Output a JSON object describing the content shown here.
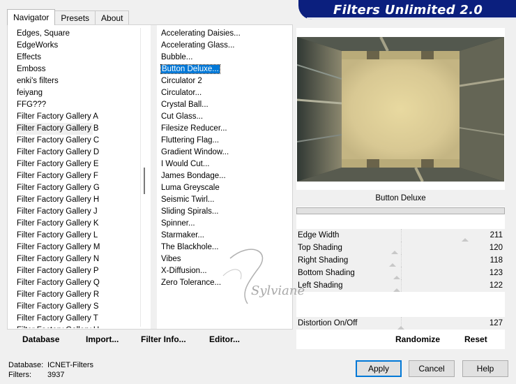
{
  "window": {
    "title": "Filters Unlimited 2.0"
  },
  "tabs": [
    {
      "label": "Navigator",
      "active": true
    },
    {
      "label": "Presets",
      "active": false
    },
    {
      "label": "About",
      "active": false
    }
  ],
  "categories": {
    "items": [
      "Edges, Square",
      "EdgeWorks",
      "Effects",
      "Emboss",
      "enki's filters",
      "feiyang",
      "FFG???",
      "Filter Factory Gallery A",
      "Filter Factory Gallery B",
      "Filter Factory Gallery C",
      "Filter Factory Gallery D",
      "Filter Factory Gallery E",
      "Filter Factory Gallery F",
      "Filter Factory Gallery G",
      "Filter Factory Gallery H",
      "Filter Factory Gallery J",
      "Filter Factory Gallery K",
      "Filter Factory Gallery L",
      "Filter Factory Gallery M",
      "Filter Factory Gallery N",
      "Filter Factory Gallery P",
      "Filter Factory Gallery Q",
      "Filter Factory Gallery R",
      "Filter Factory Gallery S",
      "Filter Factory Gallery T",
      "Filter Factory Gallery U"
    ],
    "selected": "Filter Factory Gallery B"
  },
  "filters": {
    "items": [
      "Accelerating Daisies...",
      "Accelerating Glass...",
      "Bubble...",
      "Button Deluxe...",
      "Circulator 2",
      "Circulator...",
      "Crystal Ball...",
      "Cut Glass...",
      "Filesize Reducer...",
      "Fluttering Flag...",
      "Gradient Window...",
      "I Would Cut...",
      "James Bondage...",
      "Luma Greyscale",
      "Seismic Twirl...",
      "Sliding Spirals...",
      "Spinner...",
      "Starmaker...",
      "The Blackhole...",
      "Vibes",
      "X-Diffusion...",
      "Zero Tolerance..."
    ],
    "selected": "Button Deluxe..."
  },
  "left_buttons": {
    "database": "Database",
    "import": "Import...",
    "filter_info": "Filter Info...",
    "editor": "Editor..."
  },
  "preview": {
    "filter_name": "Button Deluxe"
  },
  "params": [
    {
      "label": "Edge Width",
      "value": "211",
      "level": 0.83
    },
    {
      "label": "Top Shading",
      "value": "120",
      "level": 0.47
    },
    {
      "label": "Right Shading",
      "value": "118",
      "level": 0.46
    },
    {
      "label": "Bottom Shading",
      "value": "123",
      "level": 0.48
    },
    {
      "label": "Left Shading",
      "value": "122",
      "level": 0.48
    },
    {
      "label": "",
      "value": "",
      "level": null
    },
    {
      "label": "",
      "value": "",
      "level": null
    },
    {
      "label": "Distortion On/Off",
      "value": "127",
      "level": 0.5
    }
  ],
  "right_buttons": {
    "randomize": "Randomize",
    "reset": "Reset"
  },
  "status": {
    "database_label": "Database:",
    "database_value": "ICNET-Filters",
    "filters_label": "Filters:",
    "filters_value": "3937"
  },
  "dialog_buttons": {
    "apply": "Apply",
    "cancel": "Cancel",
    "help": "Help"
  },
  "watermark": {
    "text": "Sylviane"
  },
  "colors": {
    "selection": "#0078d7",
    "banner": "#0b1f7e",
    "preview_center": "#e8dca4"
  }
}
